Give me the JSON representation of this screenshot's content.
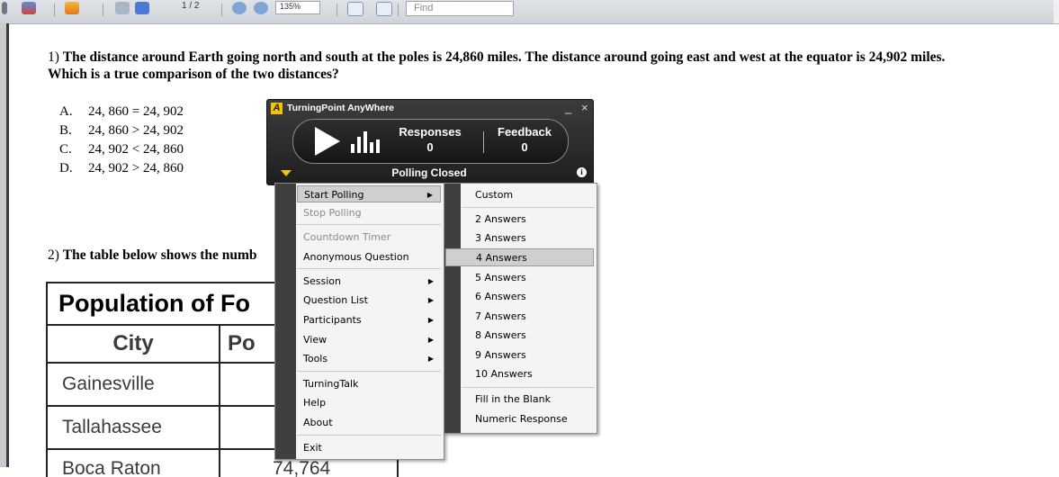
{
  "toolbar": {
    "page_indicator": "1 / 2",
    "zoom": "135%",
    "find_placeholder": "Find"
  },
  "question1": {
    "number": "1)",
    "text": "The distance around Earth going north and south at the poles is 24,860 miles. The distance around going east and west at the equator is 24,902 miles.",
    "text2": "Which is a true comparison of the two distances?",
    "choices": [
      {
        "label": "A.",
        "text": "24, 860 = 24, 902"
      },
      {
        "label": "B.",
        "text": "24, 860 > 24, 902"
      },
      {
        "label": "C.",
        "text": "24, 902 < 24, 860"
      },
      {
        "label": "D.",
        "text": "24, 902 > 24, 860"
      }
    ]
  },
  "question2": {
    "number": "2)",
    "text": "The table below shows the numb"
  },
  "table": {
    "title": "Population of Fo",
    "headers": [
      "City",
      "Po"
    ],
    "rows": [
      {
        "city": "Gainesville",
        "pop": ""
      },
      {
        "city": "Tallahassee",
        "pop": ""
      },
      {
        "city": "Boca Raton",
        "pop": "74,764"
      }
    ]
  },
  "turningpoint": {
    "title": "TurningPoint AnyWhere",
    "logo_letter": "A",
    "minimize": "_",
    "close": "×",
    "responses_label": "Responses",
    "responses_value": "0",
    "feedback_label": "Feedback",
    "feedback_value": "0",
    "status": "Polling Closed",
    "info": "i",
    "accent": "#f2c400"
  },
  "main_menu": {
    "items": [
      {
        "label": "Start Polling",
        "submenu": true,
        "state": "active"
      },
      {
        "label": "Stop Polling",
        "state": "disabled"
      },
      {
        "label": "Countdown Timer",
        "state": "disabled"
      },
      {
        "label": "Anonymous Question"
      },
      {
        "label": "Session",
        "submenu": true
      },
      {
        "label": "Question List",
        "submenu": true
      },
      {
        "label": "Participants",
        "submenu": true
      },
      {
        "label": "View",
        "submenu": true
      },
      {
        "label": "Tools",
        "submenu": true
      },
      {
        "label": "TurningTalk"
      },
      {
        "label": "Help"
      },
      {
        "label": "About"
      },
      {
        "label": "Exit"
      }
    ],
    "submenu_arrow": "▶"
  },
  "sub_menu": {
    "items": [
      {
        "label": "Custom"
      },
      {
        "label": "2 Answers"
      },
      {
        "label": "3 Answers"
      },
      {
        "label": "4 Answers",
        "state": "active"
      },
      {
        "label": "5 Answers"
      },
      {
        "label": "6 Answers"
      },
      {
        "label": "7 Answers"
      },
      {
        "label": "8 Answers"
      },
      {
        "label": "9 Answers"
      },
      {
        "label": "10 Answers"
      },
      {
        "label": "Fill in the Blank"
      },
      {
        "label": "Numeric Response"
      }
    ]
  }
}
